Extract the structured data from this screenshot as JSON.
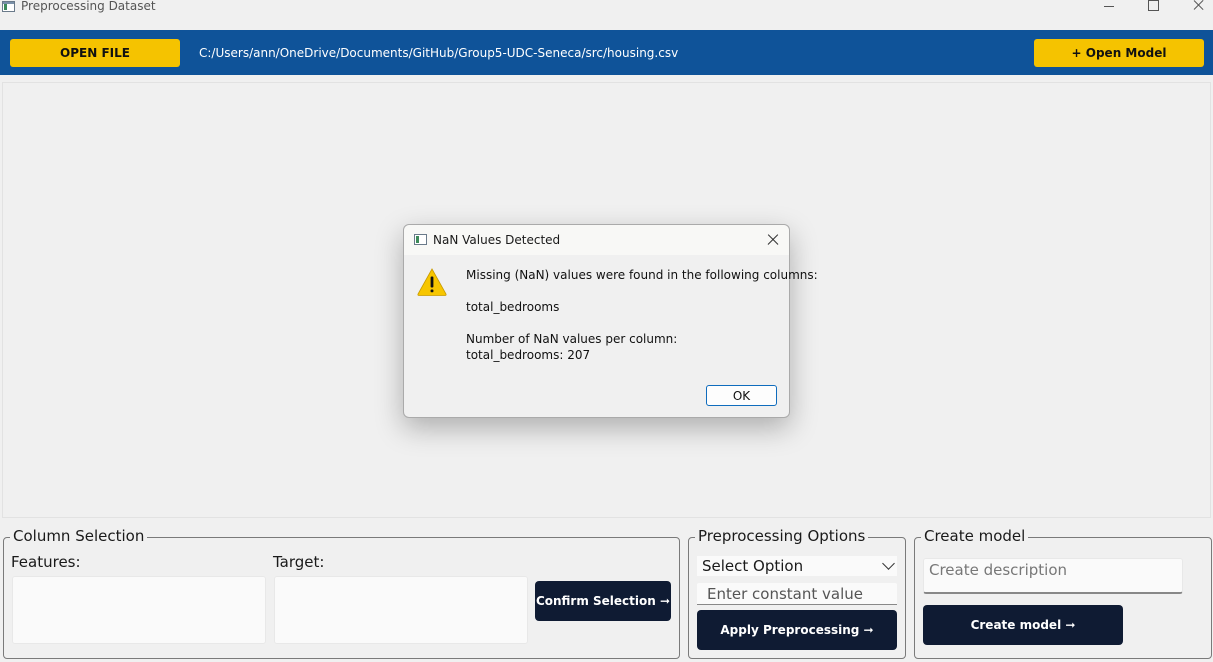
{
  "window": {
    "title": "Preprocessing Dataset"
  },
  "toolbar": {
    "open_file_label": "OPEN FILE",
    "file_path": "C:/Users/ann/OneDrive/Documents/GitHub/Group5-UDC-Seneca/src/housing.csv",
    "open_model_label": "+ Open Model"
  },
  "column_selection": {
    "title": "Column Selection",
    "features_label": "Features:",
    "target_label": "Target:",
    "confirm_label": "Confirm Selection ➞"
  },
  "preprocessing_options": {
    "title": "Preprocessing Options",
    "select_value": "Select Option",
    "constant_placeholder": "Enter constant value",
    "apply_label": "Apply Preprocessing ➞"
  },
  "create_model": {
    "title": "Create model",
    "description_placeholder": "Create description",
    "create_label": "Create model ➞"
  },
  "dialog": {
    "title": "NaN Values Detected",
    "message_line1": "Missing (NaN) values were found in the following columns:",
    "columns_line": "total_bedrooms",
    "count_header": "Number of NaN values per column:",
    "count_line": "total_bedrooms: 207",
    "ok_label": "OK",
    "icon": "warning-icon"
  },
  "colors": {
    "toolbar_blue": "#0f5399",
    "accent_yellow": "#f5c300",
    "button_navy": "#0f1b33",
    "dialog_focus": "#0f6cbd"
  }
}
